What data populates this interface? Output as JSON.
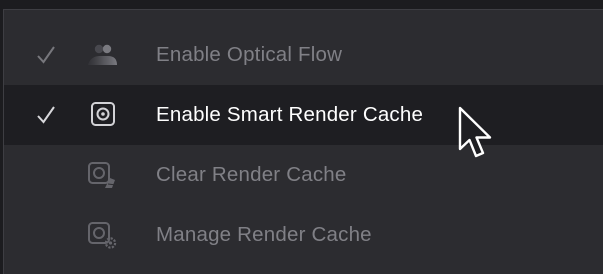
{
  "menu": {
    "items": [
      {
        "label": "Enable Optical Flow",
        "checked": true,
        "icon": "optical-flow-icon",
        "state": "disabled"
      },
      {
        "label": "Enable Smart Render Cache",
        "checked": true,
        "icon": "render-cache-icon",
        "state": "hovered"
      },
      {
        "label": "Clear Render Cache",
        "checked": false,
        "icon": "clear-render-cache-icon",
        "state": "disabled"
      },
      {
        "label": "Manage Render Cache",
        "checked": false,
        "icon": "manage-render-cache-icon",
        "state": "disabled"
      }
    ]
  },
  "colors": {
    "menu_background": "#2c2c30",
    "hover_background": "#1e1e22",
    "text_active": "#ffffff",
    "text_disabled": "#808086"
  },
  "cursor": {
    "icon": "mouse-pointer-icon"
  }
}
